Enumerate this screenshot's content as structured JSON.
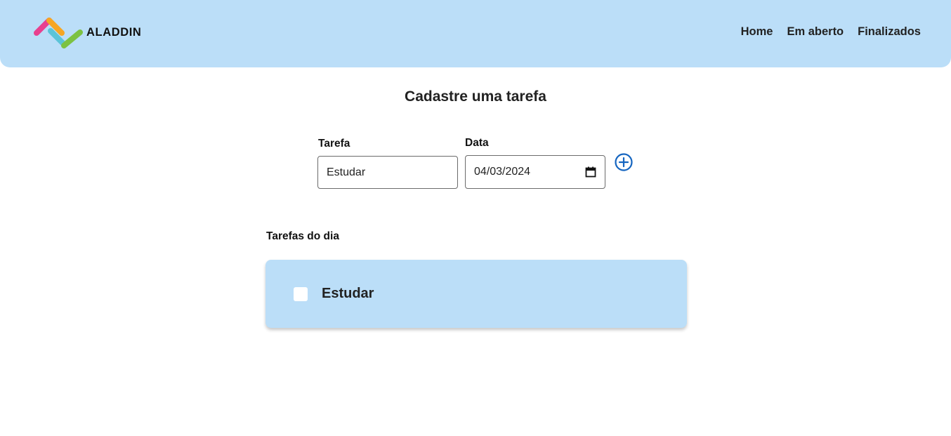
{
  "header": {
    "logo_text": "ALADDIN",
    "nav": {
      "home": "Home",
      "open": "Em aberto",
      "done": "Finalizados"
    }
  },
  "form": {
    "title": "Cadastre uma tarefa",
    "task_label": "Tarefa",
    "task_value": "Estudar",
    "date_label": "Data",
    "date_value": "04/03/2024",
    "add_icon": "plus-circle-icon"
  },
  "tasks": {
    "title": "Tarefas do dia",
    "items": [
      {
        "label": "Estudar",
        "checked": false
      }
    ]
  },
  "colors": {
    "header_bg": "#bbdef8",
    "card_bg": "#bbdef8",
    "accent": "#1565c0",
    "logo_pink": "#e8408f",
    "logo_orange": "#f6a623",
    "logo_teal": "#5bc4d8",
    "logo_green": "#7cc242"
  }
}
